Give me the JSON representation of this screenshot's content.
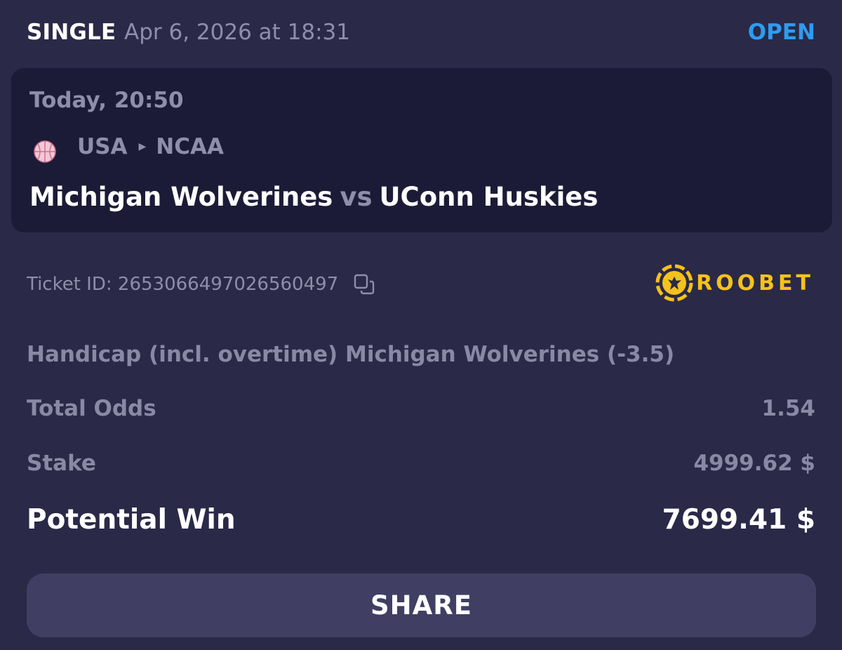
{
  "header": {
    "bet_type": "SINGLE",
    "placed_at": "Apr 6, 2026 at 18:31",
    "status": "OPEN",
    "status_color": "#2f9bf0"
  },
  "event": {
    "time": "Today, 20:50",
    "sport_icon": "basketball-icon",
    "country": "USA",
    "league": "NCAA",
    "home_team": "Michigan Wolverines",
    "vs": "vs",
    "away_team": "UConn Huskies"
  },
  "ticket": {
    "id_text": "Ticket ID: 2653066497026560497",
    "copy_icon": "copy-icon"
  },
  "brand": {
    "name": "ROOBET",
    "logo_icon": "roobet-logo-icon",
    "color": "#f5c21b"
  },
  "bet": {
    "selection": "Handicap (incl. overtime) Michigan Wolverines (-3.5)",
    "total_odds_label": "Total Odds",
    "total_odds_value": "1.54",
    "stake_label": "Stake",
    "stake_value": "4999.62 $",
    "potential_win_label": "Potential Win",
    "potential_win_value": "7699.41 $"
  },
  "actions": {
    "share_label": "SHARE"
  }
}
